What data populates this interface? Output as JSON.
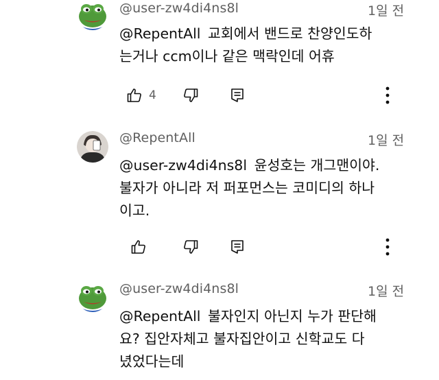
{
  "comments": [
    {
      "author": "@user-zw4di4ns8l",
      "time": "1일 전",
      "avatar": "pepe-frog-avatar",
      "mention": "@RepentAll",
      "lines": [
        "교회에서 밴드로 찬양인도하",
        "는거나 ccm이나 같은 맥락인데 어휴"
      ],
      "likes": "4"
    },
    {
      "author": "@RepentAll",
      "time": "1일 전",
      "avatar": "person-photo-avatar",
      "mention": "@user-zw4di4ns8l",
      "lines": [
        "윤성호는 개그맨이야.",
        "불자가 아니라 저 퍼포먼스는 코미디의 하나",
        "이고."
      ],
      "likes": ""
    },
    {
      "author": "@user-zw4di4ns8l",
      "time": "1일 전",
      "avatar": "pepe-frog-avatar",
      "mention": "@RepentAll",
      "lines": [
        "불자인지 아닌지 누가 판단해",
        "요? 집안자체고 불자집안이고 신학교도 다",
        "녔었다는데"
      ],
      "likes": ""
    }
  ],
  "colors": {
    "meta_text": "#606060",
    "body_text": "#0f0f0f",
    "icon": "#0f0f0f",
    "pepe_green": "#4f9a3a"
  }
}
